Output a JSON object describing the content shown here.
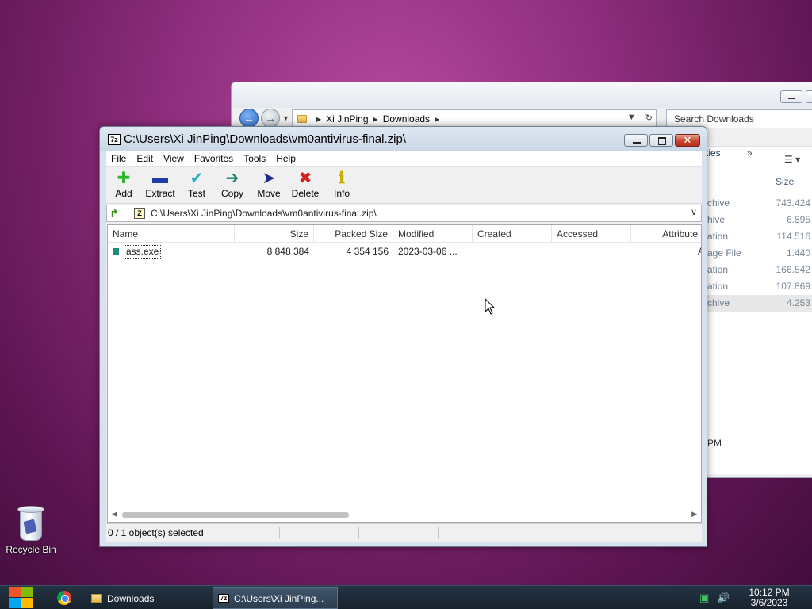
{
  "desktop": {
    "recycle_bin_label": "Recycle Bin"
  },
  "explorer": {
    "breadcrumb": [
      "Xi JinPing",
      "Downloads"
    ],
    "search_placeholder": "Search Downloads",
    "toolbar_partial": "ties",
    "toolbar_more": "»",
    "size_header": "Size",
    "rows": [
      {
        "type": "chive",
        "size": "743.424"
      },
      {
        "type": "hive",
        "size": "6.895"
      },
      {
        "type": "ation",
        "size": "114.516"
      },
      {
        "type": "age File",
        "size": "1.440"
      },
      {
        "type": "ation",
        "size": "166.542"
      },
      {
        "type": "ation",
        "size": "107.869"
      },
      {
        "type": "chive",
        "size": "4.253"
      }
    ],
    "pm_text": "PM"
  },
  "sevenzip": {
    "title": "C:\\Users\\Xi JinPing\\Downloads\\vm0antivirus-final.zip\\",
    "menu": [
      "File",
      "Edit",
      "View",
      "Favorites",
      "Tools",
      "Help"
    ],
    "toolbar": [
      {
        "label": "Add",
        "icon": "plus-icon",
        "color": "#2bb52b"
      },
      {
        "label": "Extract",
        "icon": "minus-icon",
        "color": "#1f3ba8"
      },
      {
        "label": "Test",
        "icon": "check-icon",
        "color": "#23b3c3"
      },
      {
        "label": "Copy",
        "icon": "copy-arrow-icon",
        "color": "#1f7f6a"
      },
      {
        "label": "Move",
        "icon": "move-arrow-icon",
        "color": "#1f2b8f"
      },
      {
        "label": "Delete",
        "icon": "delete-x-icon",
        "color": "#d61f1f"
      },
      {
        "label": "Info",
        "icon": "info-icon",
        "color": "#e0c400"
      }
    ],
    "path": "C:\\Users\\Xi JinPing\\Downloads\\vm0antivirus-final.zip\\",
    "columns": [
      "Name",
      "Size",
      "Packed Size",
      "Modified",
      "Created",
      "Accessed",
      "Attribute"
    ],
    "rows": [
      {
        "name": "ass.exe",
        "size": "8 848 384",
        "packed": "4 354 156",
        "modified": "2023-03-06 ...",
        "created": "",
        "accessed": "",
        "attr": "A"
      }
    ],
    "status": "0 / 1 object(s) selected"
  },
  "taskbar": {
    "items": [
      {
        "label": "Downloads",
        "active": false
      },
      {
        "label": "C:\\Users\\Xi JinPing...",
        "active": true
      }
    ],
    "time": "10:12 PM",
    "date": "3/6/2023"
  }
}
